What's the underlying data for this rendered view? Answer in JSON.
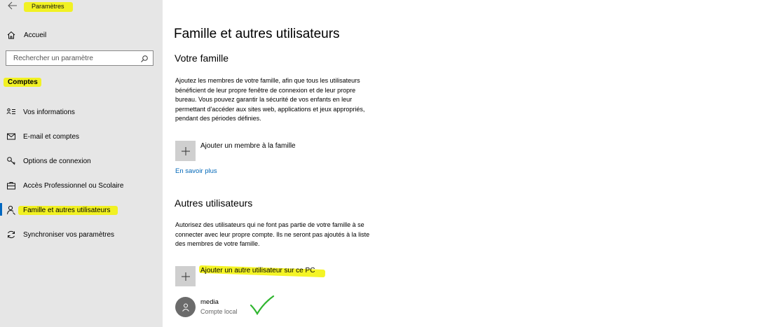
{
  "window": {
    "title": "Paramètres"
  },
  "sidebar": {
    "home_label": "Accueil",
    "search_placeholder": "Rechercher un paramètre",
    "section_title": "Comptes",
    "items": [
      {
        "label": "Vos informations",
        "icon": "person-lines-icon"
      },
      {
        "label": "E-mail et comptes",
        "icon": "mail-icon"
      },
      {
        "label": "Options de connexion",
        "icon": "key-icon"
      },
      {
        "label": "Accès Professionnel ou Scolaire",
        "icon": "briefcase-icon"
      },
      {
        "label": "Famille et autres utilisateurs",
        "icon": "person-icon",
        "active": true
      },
      {
        "label": "Synchroniser vos paramètres",
        "icon": "sync-icon"
      }
    ]
  },
  "main": {
    "title": "Famille et autres utilisateurs",
    "family": {
      "heading": "Votre famille",
      "lines": [
        "Ajoutez les membres de votre famille, afin que tous les utilisateurs",
        "bénéficient de leur propre fenêtre de connexion et de leur propre",
        "bureau. Vous pouvez garantir la sécurité de vos enfants en leur",
        "permettant d'accéder aux sites web, applications et jeux appropriés,",
        "pendant des périodes définies."
      ],
      "add_label": "Ajouter un membre à la famille",
      "learn_more": "En savoir plus"
    },
    "others": {
      "heading": "Autres utilisateurs",
      "lines": [
        "Autorisez des utilisateurs qui ne font pas partie de votre famille à se",
        "connecter avec leur propre compte. Ils ne seront pas ajoutés à la liste",
        "des membres de votre famille."
      ],
      "add_label": "Ajouter un autre utilisateur sur ce PC",
      "users": [
        {
          "name": "media",
          "type": "Compte local"
        }
      ]
    }
  },
  "colors": {
    "sidebar_bg": "#e6e6e6",
    "highlight": "#f2f200",
    "accent": "#0067c0",
    "check": "#2fb52f"
  }
}
